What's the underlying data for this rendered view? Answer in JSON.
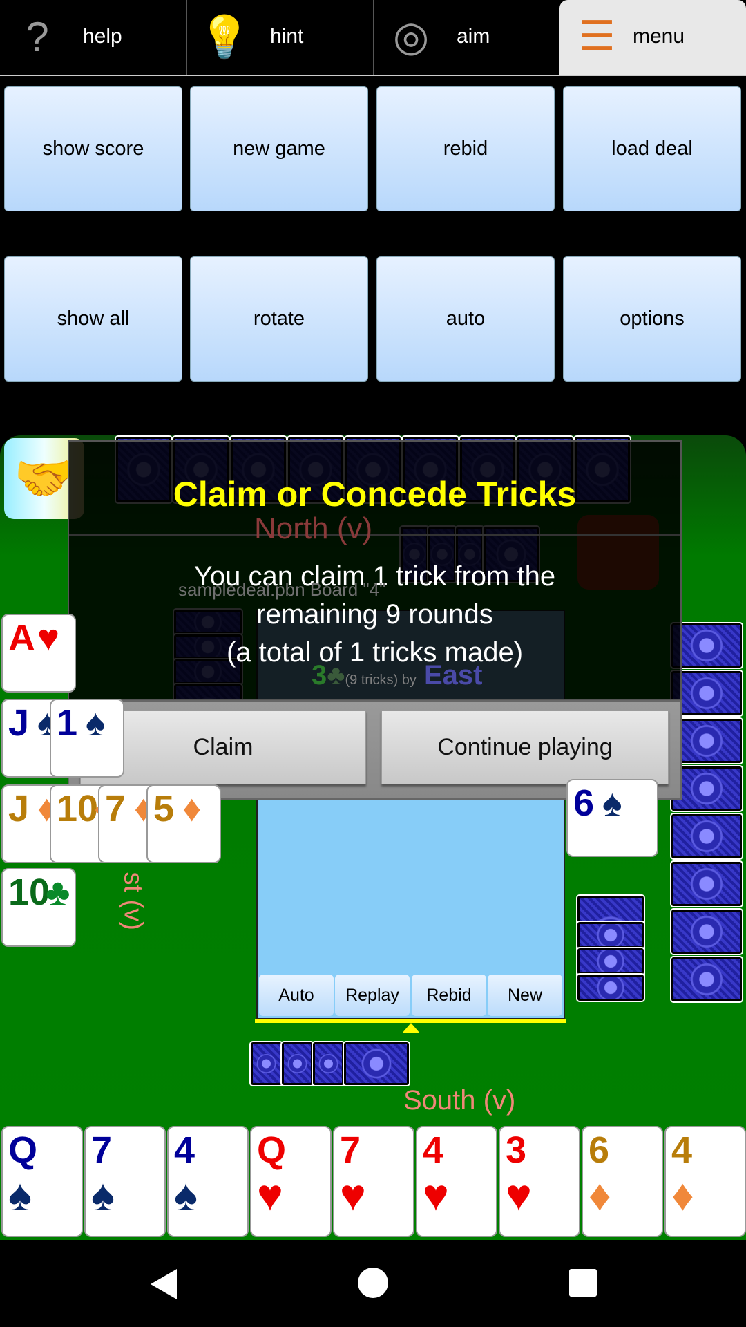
{
  "topbar": {
    "tabs": [
      {
        "label": "help",
        "icon": "help-bubble-icon"
      },
      {
        "label": "hint",
        "icon": "lightbulb-icon"
      },
      {
        "label": "aim",
        "icon": "target-dart-icon"
      },
      {
        "label": "menu",
        "icon": "menu-wrench-icon",
        "active": true
      }
    ]
  },
  "menu_buttons": [
    "show score",
    "new game",
    "rebid",
    "load deal",
    "show all",
    "rotate",
    "auto",
    "options"
  ],
  "table": {
    "background_labels": {
      "north": "North (v)",
      "deal": "sampledeal.pbn Board \"4\"",
      "contract_level": "3",
      "contract_suit": "♣",
      "contract_tricks": "(9 tricks) by",
      "declarer": "East"
    },
    "west_label": "st (v)",
    "south_label": "South (v)",
    "west_rows": [
      [
        {
          "rank": "A",
          "suit": "♥"
        }
      ],
      [
        {
          "rank": "J",
          "suit": "♠"
        },
        {
          "rank": "1",
          "suit": "♠"
        }
      ],
      [
        {
          "rank": "J",
          "suit": "♦"
        },
        {
          "rank": "10",
          "suit": "♦"
        },
        {
          "rank": "7",
          "suit": "♦"
        },
        {
          "rank": "5",
          "suit": "♦"
        }
      ],
      [
        {
          "rank": "10",
          "suit": "♣"
        }
      ]
    ],
    "east_played": {
      "rank": "6",
      "suit": "♠"
    },
    "south_hand": [
      {
        "rank": "Q",
        "suit": "♠"
      },
      {
        "rank": "7",
        "suit": "♠"
      },
      {
        "rank": "4",
        "suit": "♠"
      },
      {
        "rank": "Q",
        "suit": "♥"
      },
      {
        "rank": "7",
        "suit": "♥"
      },
      {
        "rank": "4",
        "suit": "♥"
      },
      {
        "rank": "3",
        "suit": "♥"
      },
      {
        "rank": "6",
        "suit": "♦"
      },
      {
        "rank": "4",
        "suit": "♦"
      }
    ],
    "panel_buttons": [
      "Auto",
      "Replay",
      "Rebid",
      "New"
    ],
    "suit_colors": {
      "♠": "#0a2a6a",
      "♥": "#ee0000",
      "♦": "#f0883a",
      "♣": "#0a8a2a"
    },
    "rank_colors": {
      "♠": "#000099",
      "♥": "#ee0000",
      "♦": "#b87d0a",
      "♣": "#0a6a1a"
    }
  },
  "dialog": {
    "title": "Claim or Concede Tricks",
    "lines": [
      "You can claim 1 trick from the",
      "remaining 9 rounds",
      "(a total of 1 tricks made)"
    ],
    "claim": "Claim",
    "continue": "Continue playing",
    "title_color": "#ffff00"
  }
}
